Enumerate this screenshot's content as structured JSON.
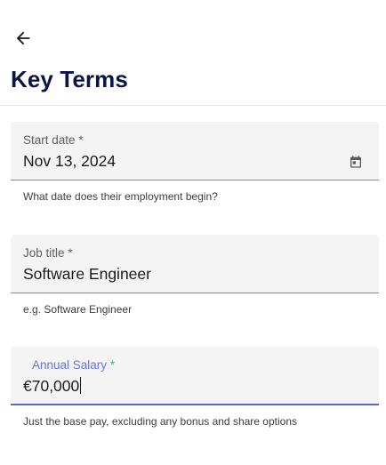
{
  "header": {
    "back_icon": "arrow-left-icon",
    "title": "Key Terms"
  },
  "form": {
    "start_date": {
      "label": "Start date",
      "required_marker": "*",
      "value": "Nov 13, 2024",
      "icon": "calendar-icon",
      "hint": "What date does their employment begin?"
    },
    "job_title": {
      "label": "Job title",
      "required_marker": "*",
      "value": "Software Engineer",
      "hint": "e.g. Software Engineer"
    },
    "annual_salary": {
      "label": "Annual Salary",
      "required_marker": "*",
      "value": "€70,000",
      "hint": "Just the base pay, excluding any bonus and share options",
      "focused": true
    }
  },
  "colors": {
    "title": "#0a1647",
    "focus_accent": "#5a68c9",
    "focused_label": "#6a75d8",
    "required_focused": "#1dbf9a",
    "field_background": "#f4f4f4"
  }
}
